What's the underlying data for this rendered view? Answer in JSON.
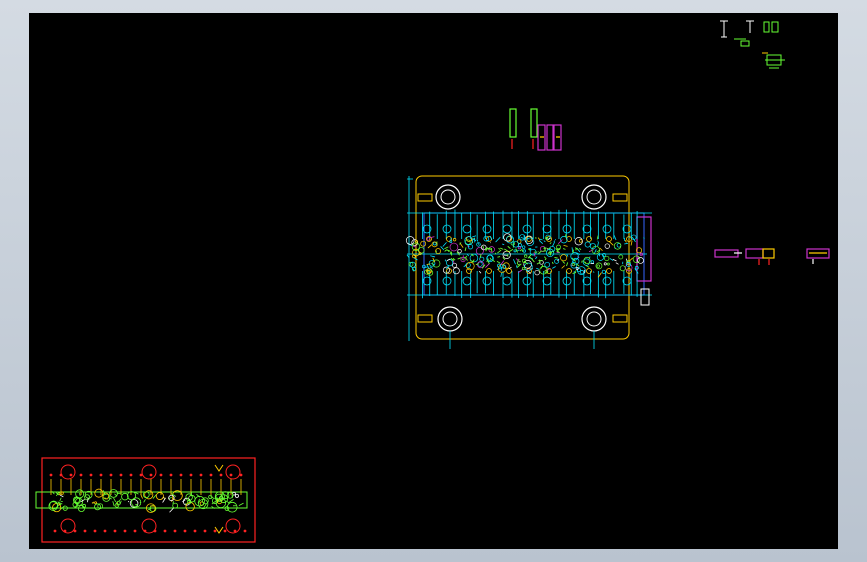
{
  "app": {
    "background_color": "#c8d0da",
    "canvas_color": "#000000"
  },
  "drawing": {
    "colors": {
      "cyan": "#00e5ff",
      "green": "#66ff33",
      "yellow": "#ffcc00",
      "red": "#ff2222",
      "magenta": "#cc33cc",
      "blue": "#3366ff",
      "white": "#ffffff",
      "orange": "#ff8800"
    },
    "views": [
      "small-parts-top-right",
      "punch-parts-top",
      "die-plate-main-view",
      "side-details-right",
      "strip-layout-bottom-left"
    ]
  }
}
